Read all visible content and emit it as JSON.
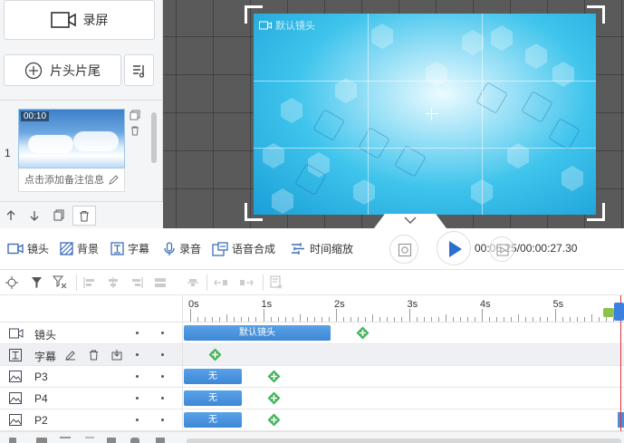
{
  "left_panel": {
    "record_label": "录屏",
    "intro_outro_label": "片头片尾",
    "scene_number": "1",
    "thumb_time": "00:10",
    "note_placeholder": "点击添加备注信息"
  },
  "preview": {
    "watermark": "默认镜头"
  },
  "toolbar": {
    "lens": "镜头",
    "background": "背景",
    "subtitle": "字幕",
    "record_audio": "录音",
    "tts": "语音合成",
    "time_scale": "时间缩放"
  },
  "playback": {
    "time_display": "00:06.25/00:00:27.30"
  },
  "timeline": {
    "ruler_labels": [
      "0s",
      "1s",
      "2s",
      "3s",
      "4s",
      "5s"
    ],
    "tracks": [
      {
        "name": "镜头",
        "clip_label": "默认镜头"
      },
      {
        "name": "字幕"
      },
      {
        "name": "P3",
        "clip_label": "无"
      },
      {
        "name": "P4",
        "clip_label": "无"
      },
      {
        "name": "P2",
        "clip_label": "无"
      }
    ]
  },
  "colors": {
    "accent": "#3d87d6",
    "add_green": "#46b45a",
    "playhead": "#e03030"
  }
}
